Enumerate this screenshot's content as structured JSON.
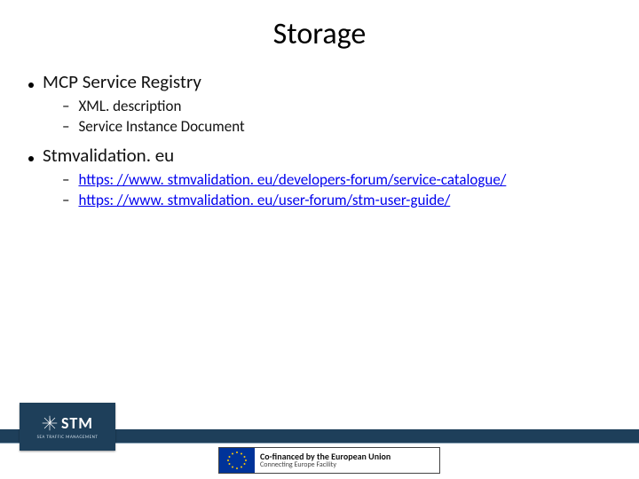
{
  "title": "Storage",
  "bullets": [
    {
      "label": "MCP Service Registry",
      "sub": [
        {
          "text": "XML. description",
          "link": false
        },
        {
          "text": "Service Instance Document",
          "link": false
        }
      ]
    },
    {
      "label": "Stmvalidation. eu",
      "sub": [
        {
          "text": "https: //www. stmvalidation. eu/developers-forum/service-catalogue/",
          "link": true
        },
        {
          "text": "https: //www. stmvalidation. eu/user-forum/stm-user-guide/",
          "link": true
        }
      ]
    }
  ],
  "footer": {
    "stm_main": "STM",
    "stm_sub": "SEA TRAFFIC MANAGEMENT",
    "eu_line1": "Co-financed by the European Union",
    "eu_line2": "Connecting Europe Facility"
  }
}
